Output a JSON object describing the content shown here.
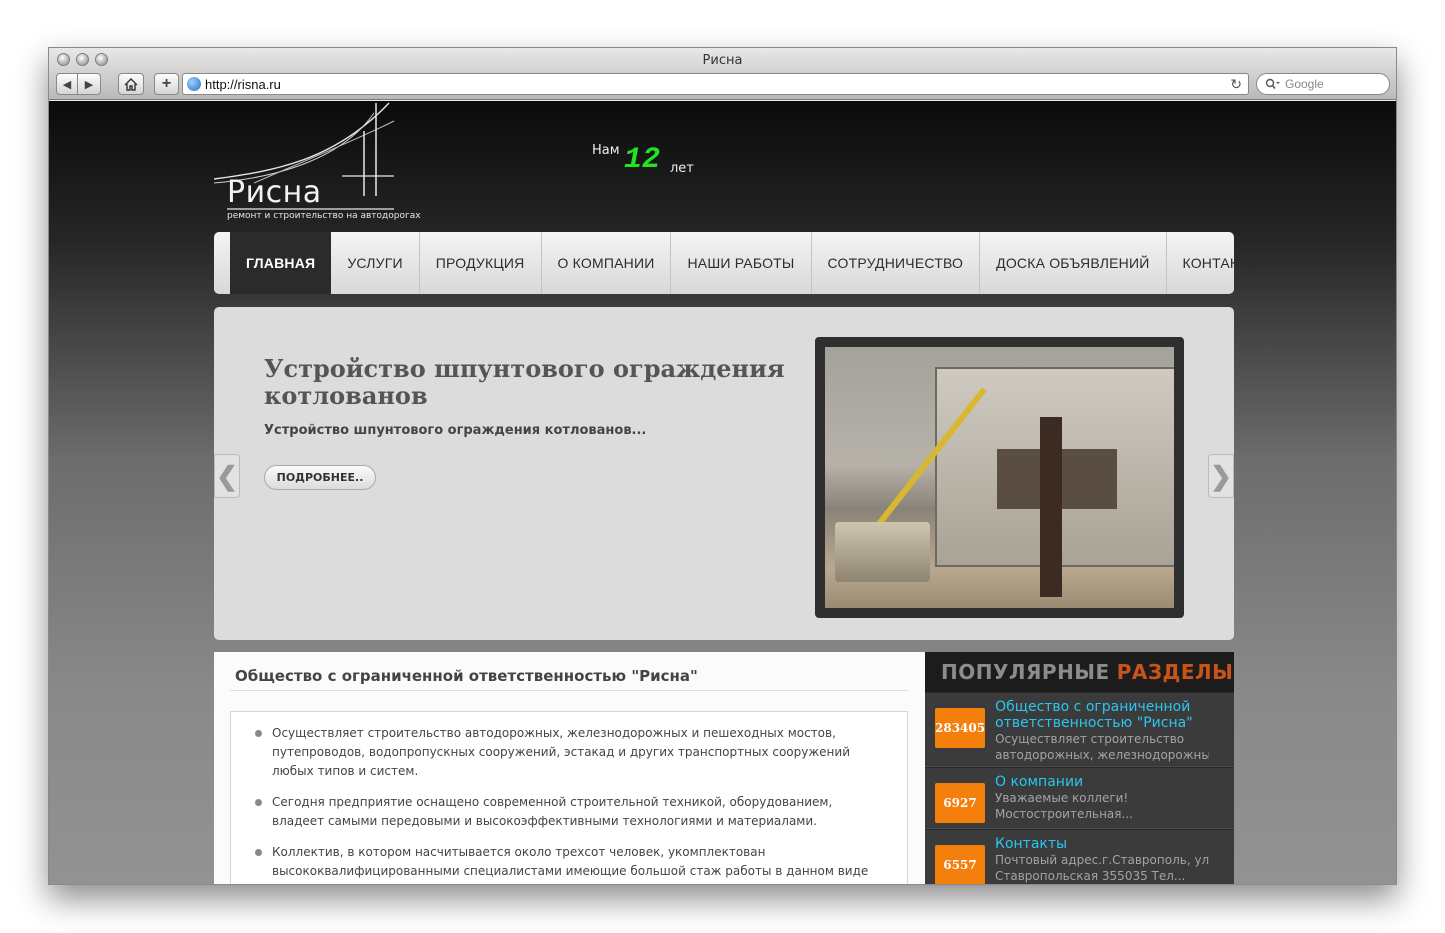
{
  "browser": {
    "window_title": "Риcна",
    "url": "http://risna.ru",
    "search_placeholder": "Google",
    "reload_icon": "↻"
  },
  "header": {
    "logo_title": "Рисна",
    "logo_subtitle": "ремонт и строительство на автодорогах",
    "years_prefix": "Нам",
    "years_number": "12",
    "years_suffix": "лет"
  },
  "nav": {
    "items": [
      {
        "label": "ГЛАВНАЯ",
        "active": true
      },
      {
        "label": "УСЛУГИ"
      },
      {
        "label": "ПРОДУКЦИЯ"
      },
      {
        "label": "О КОМПАНИИ"
      },
      {
        "label": "НАШИ РАБОТЫ"
      },
      {
        "label": "СОТРУДНИЧЕСТВО"
      },
      {
        "label": "ДОСКА ОБЪЯВЛЕНИЙ"
      },
      {
        "label": "КОНТАКТЫ"
      }
    ]
  },
  "slider": {
    "title": "Устройство шпунтового ограждения котлованов",
    "text": "Устройство шпунтового ограждения котлованов...",
    "button": "ПОДРОБНЕЕ..",
    "prev_icon": "❮",
    "next_icon": "❯"
  },
  "main": {
    "heading": "Общество с ограниченной ответственностью \"Рисна\"",
    "bullets": [
      "Осуществляет строительство автодорожных, железнодорожных и пешеходных мостов, путепроводов, водопропускных сооружений, эстакад и других транспортных сооружений любых типов и систем.",
      "Сегодня предприятие оснащено современной строительной техникой, оборудованием, владеет самыми передовыми и высокоэффективными технологиями и материалами.",
      "Коллектив, в котором насчитывается около трехсот человек, укомплектован высококвалифицированными специалистами имеющие большой стаж работы в данном виде деятельности."
    ]
  },
  "popular": {
    "head_word1": "ПОПУЛЯРНЫЕ",
    "head_word2": "РАЗДЕЛЫ",
    "items": [
      {
        "count": "283405",
        "title": "Общество с ограниченной ответственностью \"Рисна\"",
        "desc1": "Осуществляет строительство",
        "desc2": "автодорожных, железнодорожных..."
      },
      {
        "count": "6927",
        "title": "О компании",
        "desc1": "Уважаемые коллеги!",
        "desc2": "Мостостроительная..."
      },
      {
        "count": "6557",
        "title": "Контакты",
        "desc1": "Почтовый адрес.г.Ставрополь, ул.",
        "desc2": "Ставропольская 355035 Тел..."
      }
    ]
  },
  "colors": {
    "years_number": "#22e322",
    "badge": "#f47f0c",
    "popular_link": "#29c7ef",
    "popular_head_accent": "#c9541a"
  }
}
